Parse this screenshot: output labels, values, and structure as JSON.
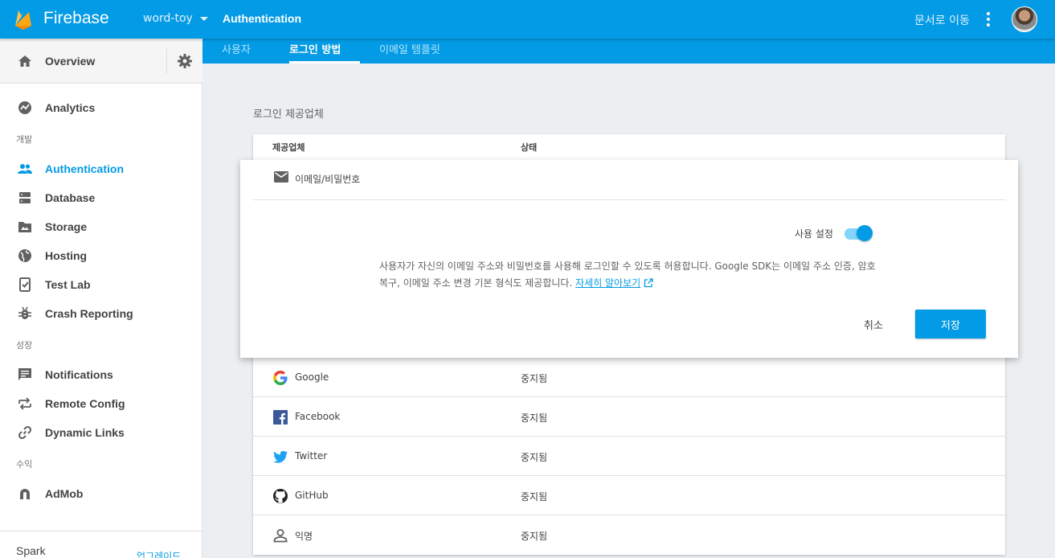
{
  "app": {
    "brand": "Firebase",
    "project": "word-toy",
    "section": "Authentication",
    "docs_link": "문서로 이동"
  },
  "sidebar": {
    "overview": "Overview",
    "analytics": "Analytics",
    "groups": {
      "develop": "개발",
      "grow": "성장",
      "earn": "수익"
    },
    "items": {
      "authentication": "Authentication",
      "database": "Database",
      "storage": "Storage",
      "hosting": "Hosting",
      "test_lab": "Test Lab",
      "crash_reporting": "Crash Reporting",
      "notifications": "Notifications",
      "remote_config": "Remote Config",
      "dynamic_links": "Dynamic Links",
      "admob": "AdMob"
    },
    "plan": "Spark",
    "upgrade": "업그레이드"
  },
  "tabs": [
    "사용자",
    "로그인 방법",
    "이메일 템플릿"
  ],
  "content": {
    "title": "로그인 제공업체",
    "columns": [
      "제공업체",
      "상태"
    ],
    "expanded": {
      "name": "이메일/비밀번호",
      "toggle_label": "사용 설정",
      "enabled": true,
      "description": "사용자가 자신의 이메일 주소와 비밀번호를 사용해 로그인할 수 있도록 허용합니다. Google SDK는 이메일 주소 인증, 암호 복구, 이메일 주소 변경 기본 형식도 제공합니다.",
      "learn_more": "자세히 알아보기",
      "cancel": "취소",
      "save": "저장"
    },
    "providers": [
      {
        "name": "Google",
        "status": "중지됨",
        "icon": "google-icon"
      },
      {
        "name": "Facebook",
        "status": "중지됨",
        "icon": "facebook-icon"
      },
      {
        "name": "Twitter",
        "status": "중지됨",
        "icon": "twitter-icon"
      },
      {
        "name": "GitHub",
        "status": "중지됨",
        "icon": "github-icon"
      },
      {
        "name": "익명",
        "status": "중지됨",
        "icon": "person-icon"
      }
    ]
  },
  "colors": {
    "primary": "#039be5",
    "background": "#eceff1"
  }
}
